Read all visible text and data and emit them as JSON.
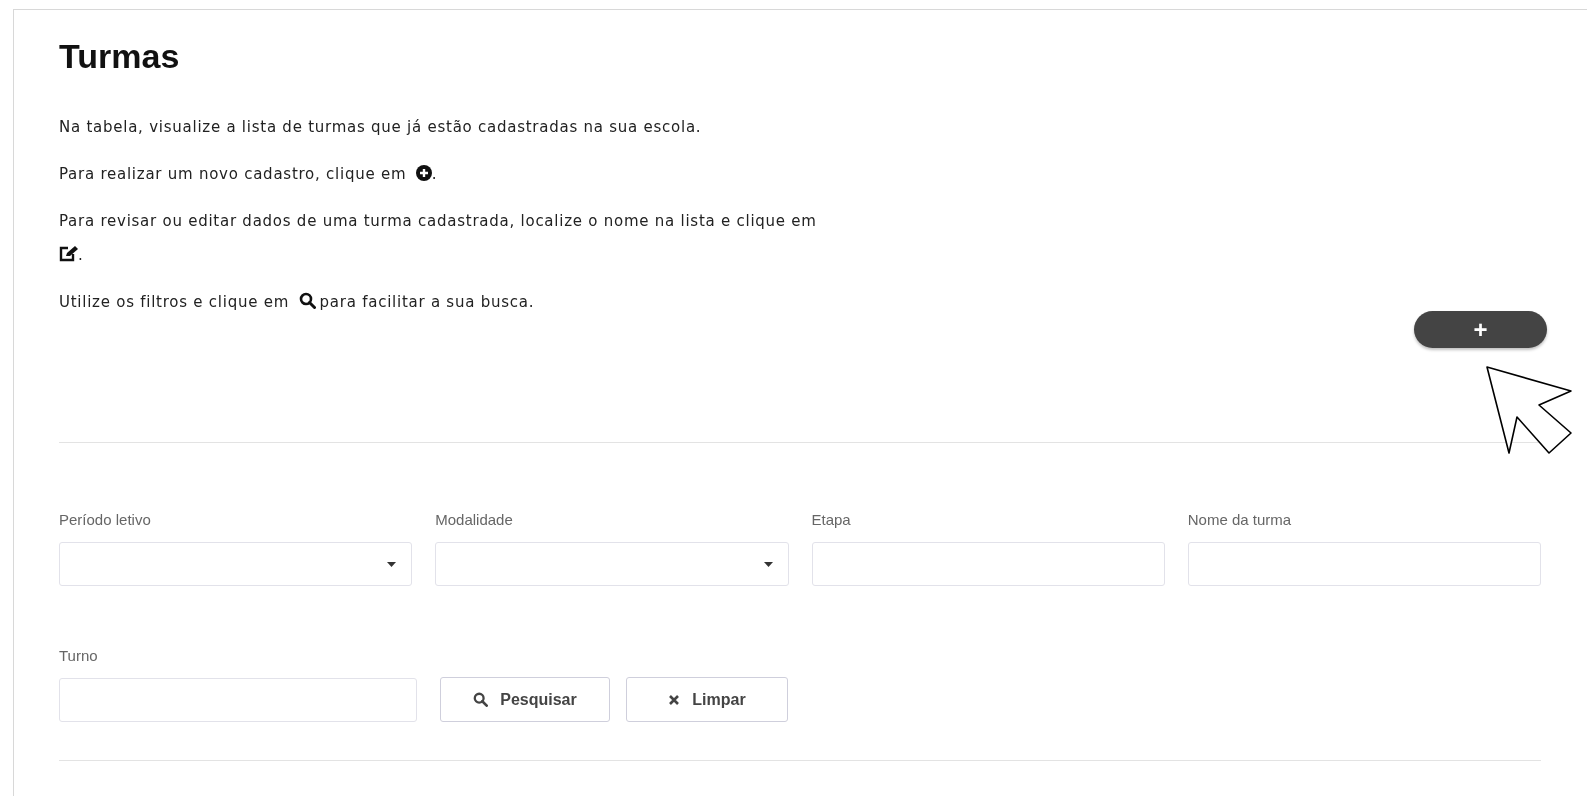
{
  "title": "Turmas",
  "paragraphs": [
    {
      "before": "Na tabela, visualize a lista de turmas que já estão cadastradas na sua escola.",
      "kind": "plain"
    },
    {
      "before": "Para realizar um novo cadastro, clique em",
      "kind": "add",
      "after": "."
    },
    {
      "before": "Para revisar ou editar dados de uma turma cadastrada, localize o nome na lista e clique em",
      "kind": "edit",
      "after": "."
    },
    {
      "before": "Utilize os filtros e clique em",
      "kind": "search",
      "after": "para facilitar a sua busca."
    }
  ],
  "add_button": {
    "label": "+"
  },
  "filters": [
    {
      "label": "Período letivo",
      "kind": "select"
    },
    {
      "label": "Modalidade",
      "kind": "select"
    },
    {
      "label": "Etapa",
      "kind": "text"
    },
    {
      "label": "Nome da turma",
      "kind": "text"
    },
    {
      "label": "Turno",
      "kind": "text"
    }
  ],
  "buttons": [
    {
      "label": "Pesquisar",
      "kind": "search"
    },
    {
      "label": "Limpar",
      "kind": "clear"
    }
  ]
}
